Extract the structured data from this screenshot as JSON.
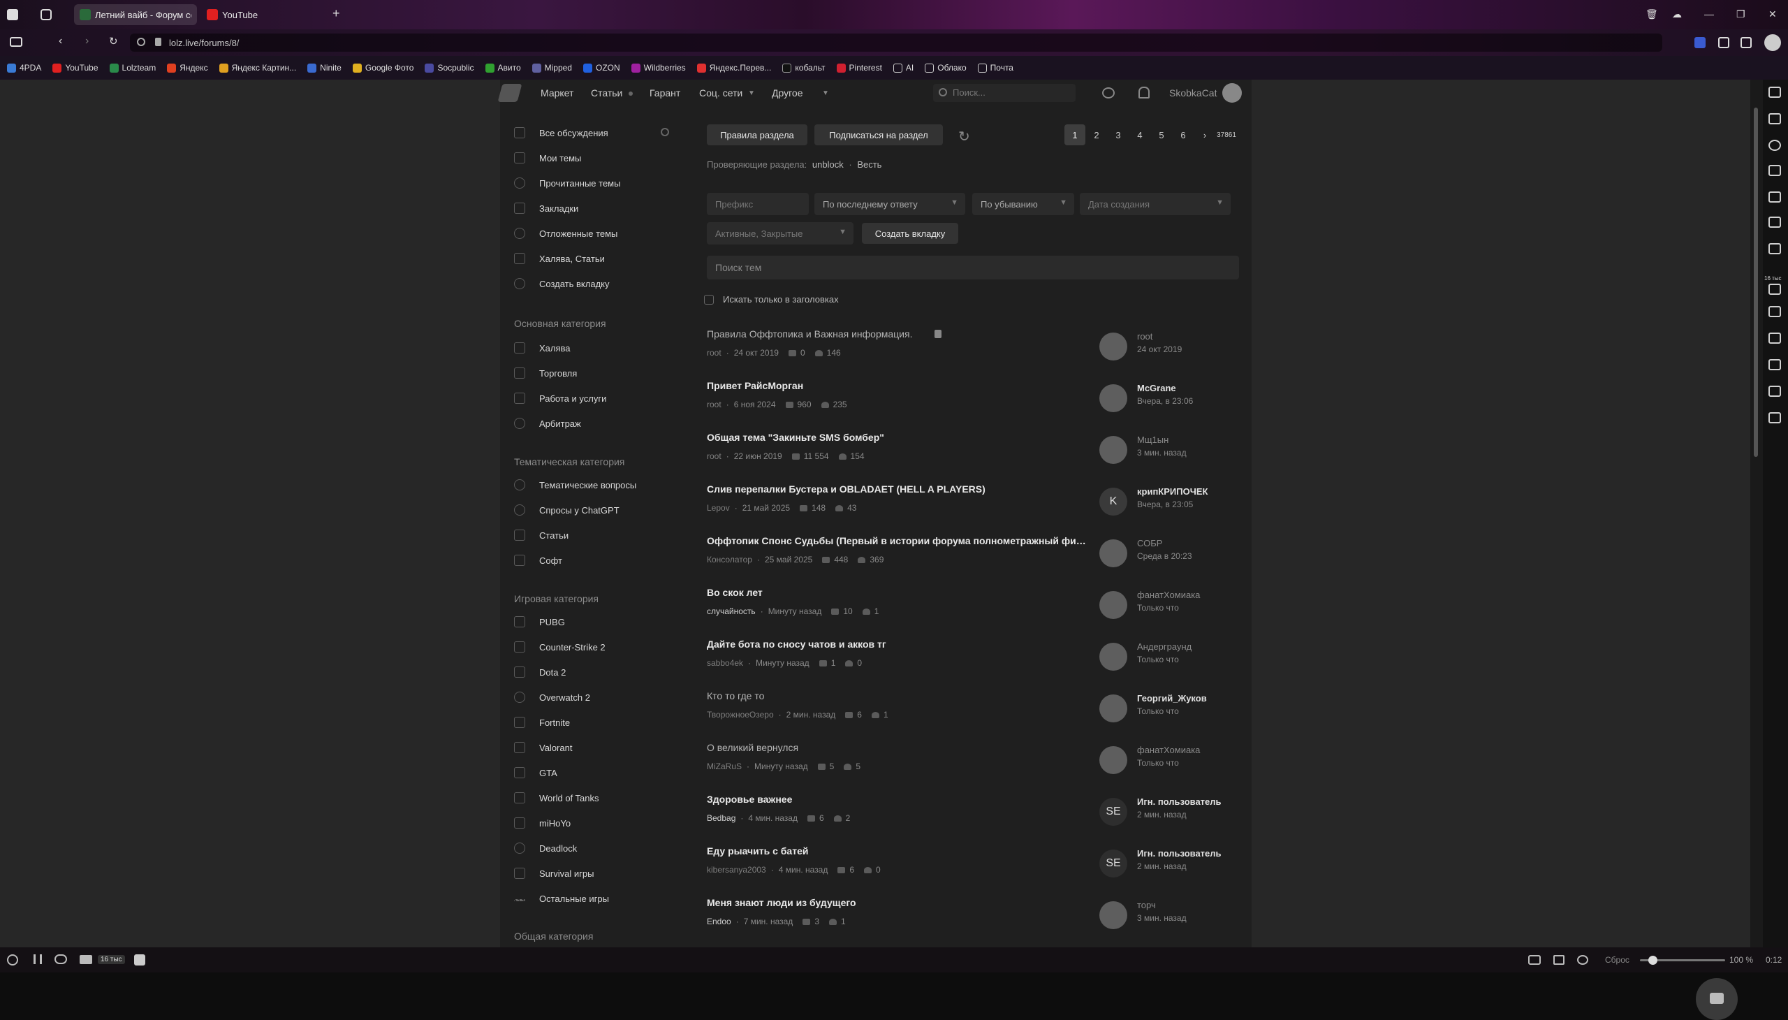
{
  "browser": {
    "tabs": [
      {
        "label": "Летний вайб - Форум соц",
        "active": true
      },
      {
        "label": "YouTube",
        "active": false
      }
    ],
    "url": "lolz.live/forums/8/",
    "bookmarks": [
      "4PDA",
      "YouTube",
      "Lolzteam",
      "Яндекс",
      "Яндекс Картин...",
      "Ninite",
      "Google Фото",
      "Socpublic",
      "Авито",
      "Mipped",
      "OZON",
      "Wildberries",
      "Яндекс.Перев...",
      "кобальт",
      "Pinterest",
      "AI",
      "Облако",
      "Почта"
    ],
    "zoom": "100 %",
    "reset_label": "Сброс",
    "time": "0:12",
    "badge": "16 тыс"
  },
  "nav": {
    "items": [
      "Маркет",
      "Статьи",
      "Гарант",
      "Соц. сети",
      "Другое"
    ],
    "search_placeholder": "Поиск...",
    "username": "SkobkaCat"
  },
  "sidebar": {
    "top": [
      "Все обсуждения",
      "Мои темы",
      "Прочитанные темы",
      "Закладки",
      "Отложенные темы",
      "Халява, Статьи",
      "Создать вкладку"
    ],
    "sections": [
      {
        "title": "Основная категория",
        "items": [
          "Халява",
          "Торговля",
          "Работа и услуги",
          "Арбитраж"
        ]
      },
      {
        "title": "Тематическая категория",
        "items": [
          "Тематические вопросы",
          "Спросы у ChatGPT",
          "Статьи",
          "Софт"
        ]
      },
      {
        "title": "Игровая категория",
        "items": [
          "PUBG",
          "Counter-Strike 2",
          "Dota 2",
          "Overwatch 2",
          "Fortnite",
          "Valorant",
          "GTA",
          "World of Tanks",
          "miHoYo",
          "Deadlock",
          "Survival игры",
          "Остальные игры"
        ]
      },
      {
        "title": "Общая категория",
        "items": []
      }
    ]
  },
  "forum": {
    "rules_button": "Правила раздела",
    "subscribe_button": "Подписаться на раздел",
    "moderators_label": "Проверяющие раздела:",
    "moderators": [
      "unblock",
      "Весть"
    ],
    "pages": [
      "1",
      "2",
      "3",
      "4",
      "5",
      "6"
    ],
    "last_page": "37861",
    "filters": {
      "prefix": "Префикс",
      "sort": "По последнему ответу",
      "order": "По убыванию",
      "date": "Дата создания",
      "state": "Активные, Закрытые",
      "create_tab": "Создать вкладку"
    },
    "search_placeholder": "Поиск тем",
    "titles_only": "Искать только в заголовках"
  },
  "threads": [
    {
      "title": "Правила Оффтопика и Важная информация.",
      "light": true,
      "author": "root",
      "date": "24 окт 2019",
      "replies": "0",
      "likes": "146",
      "last_user": "root",
      "last_time": "24 окт 2019",
      "last_dim": true,
      "avatar": ""
    },
    {
      "title": "Привет РайсМорган",
      "light": false,
      "author": "root",
      "date": "6 ноя 2024",
      "replies": "960",
      "likes": "235",
      "last_user": "McGrane",
      "last_time": "Вчера, в 23:06",
      "last_dim": false,
      "avatar": ""
    },
    {
      "title": "Общая тема \"Закиньте SMS бомбер\"",
      "light": false,
      "author": "root",
      "date": "22 июн 2019",
      "replies": "11 554",
      "likes": "154",
      "last_user": "Мщ1ын",
      "last_time": "3 мин. назад",
      "last_dim": true,
      "avatar": ""
    },
    {
      "title": "Слив перепалки Бустера и OBLADAET (HELL A PLAYERS)",
      "light": false,
      "author": "Lepov",
      "date": "21 май 2025",
      "replies": "148",
      "likes": "43",
      "last_user": "крипКРИПОЧЕК",
      "last_time": "Вчера, в 23:05",
      "last_dim": false,
      "avatar": "K"
    },
    {
      "title": "Оффтопик Спонс Судьбы (Первый в истории форума полнометражный фильм)",
      "light": false,
      "author": "Консолатор",
      "date": "25 май 2025",
      "replies": "448",
      "likes": "369",
      "last_user": "СОБР",
      "last_time": "Среда в 20:23",
      "last_dim": true,
      "avatar": ""
    },
    {
      "title": "Во скок лет",
      "light": false,
      "author": "случайность",
      "date": "Минуту назад",
      "replies": "10",
      "likes": "1",
      "last_user": "фанатХомиака",
      "last_time": "Только что",
      "last_dim": true,
      "avatar": ""
    },
    {
      "title": "Дайте бота по сносу чатов и акков тг",
      "light": false,
      "author": "sabbo4ek",
      "date": "Минуту назад",
      "replies": "1",
      "likes": "0",
      "last_user": "Андерграунд",
      "last_time": "Только что",
      "last_dim": true,
      "avatar": ""
    },
    {
      "title": "Кто то где то",
      "light": true,
      "author": "ТворожноеОзеро",
      "date": "2 мин. назад",
      "replies": "6",
      "likes": "1",
      "last_user": "Георгий_Жуков",
      "last_time": "Только что",
      "last_dim": false,
      "avatar": ""
    },
    {
      "title": "О великий вернулся",
      "light": true,
      "author": "MiZaRuS",
      "date": "Минуту назад",
      "replies": "5",
      "likes": "5",
      "last_user": "фанатХомиака",
      "last_time": "Только что",
      "last_dim": true,
      "avatar": ""
    },
    {
      "title": "Здоровье важнее",
      "light": false,
      "author": "Bedbag",
      "date": "4 мин. назад",
      "replies": "6",
      "likes": "2",
      "last_user": "Игн. пользователь",
      "last_time": "2 мин. назад",
      "last_dim": false,
      "avatar": "SE"
    },
    {
      "title": "Еду рыачить с батей",
      "light": false,
      "author": "kibersanya2003",
      "date": "4 мин. назад",
      "replies": "6",
      "likes": "0",
      "last_user": "Игн. пользователь",
      "last_time": "2 мин. назад",
      "last_dim": false,
      "avatar": "SE"
    },
    {
      "title": "Меня знают люди из будущего",
      "light": false,
      "author": "Endoo",
      "date": "7 мин. назад",
      "replies": "3",
      "likes": "1",
      "last_user": "торч",
      "last_time": "3 мин. назад",
      "last_dim": true,
      "avatar": ""
    }
  ]
}
